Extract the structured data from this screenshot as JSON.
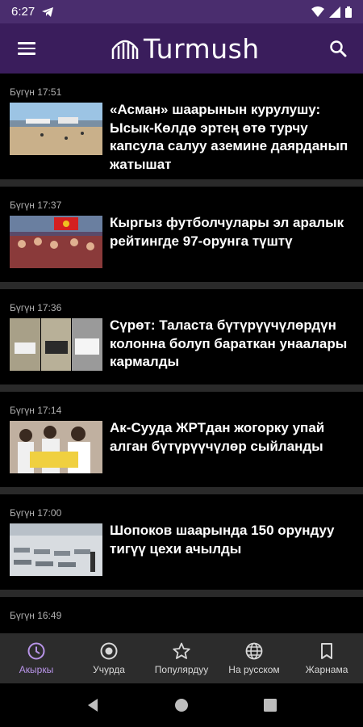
{
  "status_bar": {
    "time": "6:27"
  },
  "app": {
    "logo_text": "Turmush"
  },
  "news": [
    {
      "time": "Бүгүн 17:51",
      "headline": "«Асман» шаарынын курулушу: Ысык-Көлдө эртең өтө турчу капсула салуу аземине даярданып жатышат"
    },
    {
      "time": "Бүгүн 17:37",
      "headline": "Кыргыз футболчулары эл аралык рейтингде 97-орунга түштү"
    },
    {
      "time": "Бүгүн 17:36",
      "headline": "Сүрөт: Таласта бүтүрүүчүлөрдүн колонна болуп бараткан унаалары кармалды"
    },
    {
      "time": "Бүгүн 17:14",
      "headline": "Ак-Сууда ЖРТдан жогорку упай алган бүтүрүүчүлөр сыйланды"
    },
    {
      "time": "Бүгүн 17:00",
      "headline": "Шопоков шаарында 150 орундуу тигүү цехи ачылды"
    },
    {
      "time": "Бүгүн 16:49",
      "headline": ""
    }
  ],
  "bottom_nav": [
    {
      "label": "Акыркы",
      "icon": "clock-icon",
      "active": true
    },
    {
      "label": "Учурда",
      "icon": "radio-icon",
      "active": false
    },
    {
      "label": "Популярдуу",
      "icon": "star-icon",
      "active": false
    },
    {
      "label": "На русском",
      "icon": "globe-icon",
      "active": false
    },
    {
      "label": "Жарнама",
      "icon": "bookmark-icon",
      "active": false
    }
  ],
  "colors": {
    "status_bar": "#4a2d6e",
    "app_bar": "#3a1d5c",
    "accent": "#b894e8",
    "nav_bg": "#2c2c2c"
  }
}
